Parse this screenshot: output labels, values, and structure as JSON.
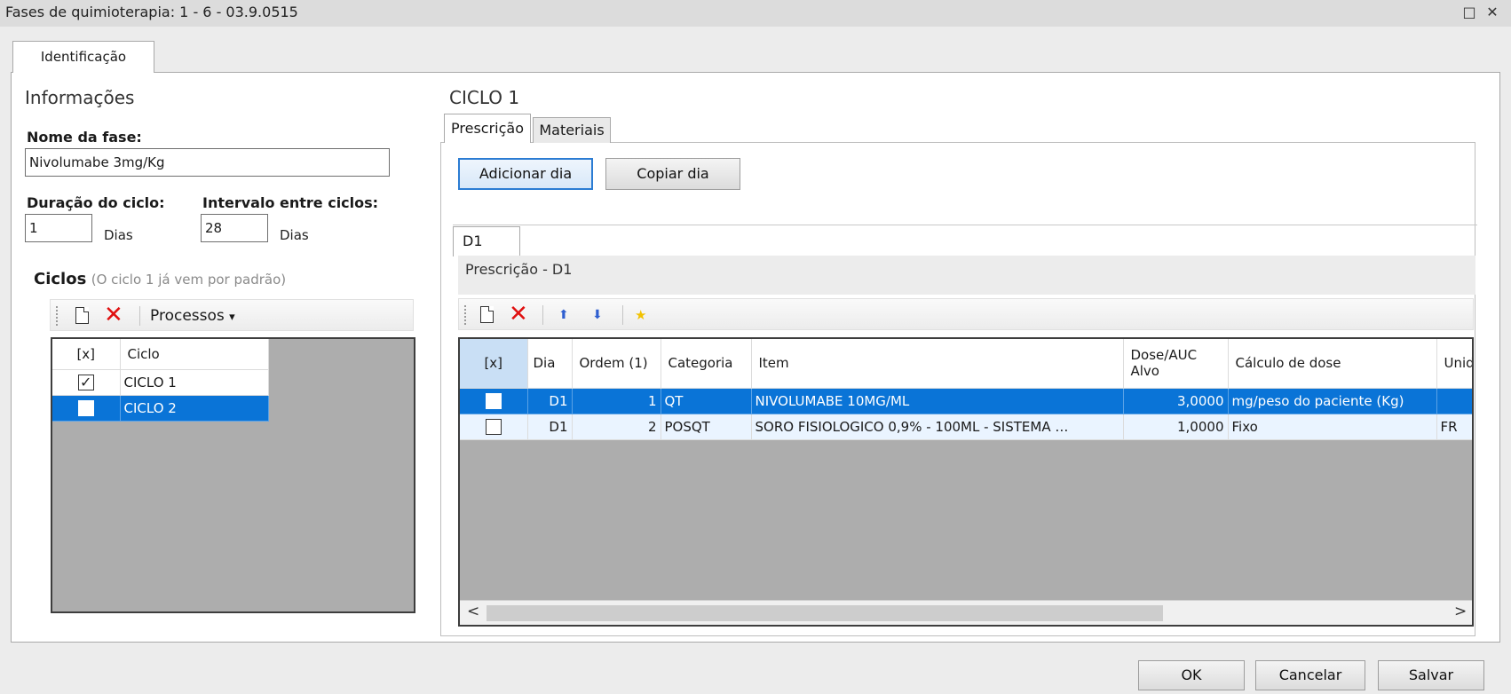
{
  "window": {
    "title": "Fases de quimioterapia: 1 - 6 - 03.9.0515",
    "maximize_icon": "□",
    "close_icon": "✕"
  },
  "outer_tab": {
    "label": "Identificação"
  },
  "info": {
    "section_title": "Informações",
    "phase_name_label": "Nome da fase:",
    "phase_name_value": "Nivolumabe 3mg/Kg",
    "cycle_duration_label": "Duração do ciclo:",
    "cycle_duration_value": "1",
    "cycle_duration_unit": "Dias",
    "interval_label": "Intervalo entre ciclos:",
    "interval_value": "28",
    "interval_unit": "Dias"
  },
  "cycles": {
    "title": "Ciclos",
    "hint": "(O ciclo 1 já vem por padrão)",
    "toolbar": {
      "processos_label": "Processos",
      "dropdown_icon": "▾"
    },
    "headers": [
      "[x]",
      "Ciclo"
    ],
    "rows": [
      {
        "checked": true,
        "name": "CICLO 1"
      },
      {
        "checked": false,
        "name": "CICLO 2"
      }
    ]
  },
  "cycle_detail": {
    "title": "CICLO 1",
    "tabs": [
      "Prescrição",
      "Materiais"
    ],
    "add_day_button": "Adicionar dia",
    "copy_day_button": "Copiar dia",
    "day_tab": "D1",
    "prescription_caption": "Prescrição - D1",
    "grid": {
      "headers": [
        "[x]",
        "Dia",
        "Ordem (1)",
        "Categoria",
        "Item",
        "Dose/AUC Alvo",
        "Cálculo de dose",
        "Unid"
      ],
      "rows": [
        {
          "dia": "D1",
          "ordem": "1",
          "categoria": "QT",
          "item": "NIVOLUMABE 10MG/ML",
          "dose": "3,0000",
          "calculo": "mg/peso do paciente (Kg)",
          "unid": ""
        },
        {
          "dia": "D1",
          "ordem": "2",
          "categoria": "POSQT",
          "item": "SORO FISIOLOGICO 0,9% - 100ML - SISTEMA …",
          "dose": "1,0000",
          "calculo": "Fixo",
          "unid": "FR"
        }
      ]
    },
    "scroll_left_icon": "<",
    "scroll_right_icon": ">"
  },
  "footer": {
    "ok": "OK",
    "cancel": "Cancelar",
    "save": "Salvar"
  }
}
